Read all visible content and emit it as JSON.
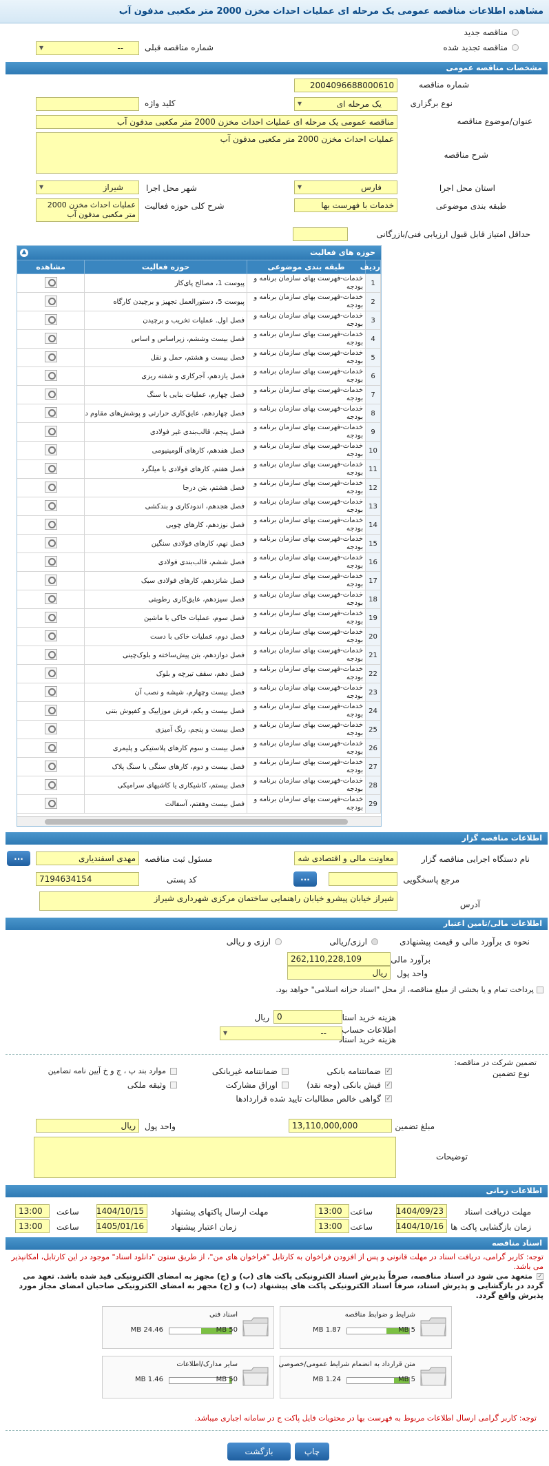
{
  "page_title": "مشاهده اطلاعات مناقصه عمومی یک مرحله ای عملیات احداث مخزن 2000 متر مکعبی مدفون آب",
  "top": {
    "new_tender": "مناقصه جدید",
    "renewed_tender": "مناقصه تجدید شده",
    "prev_number_label": "شماره مناقصه قبلی",
    "prev_number_value": "--"
  },
  "general": {
    "header": "مشخصات مناقصه عمومی",
    "number_label": "شماره مناقصه",
    "number_value": "2004096688000610",
    "type_label": "نوع برگزاری",
    "type_value": "یک مرحله ای",
    "keyword_label": "کلید واژه",
    "keyword_value": "",
    "title_label": "عنوان/موضوع مناقصه",
    "title_value": "مناقصه عمومی یک مرحله ای عملیات احداث مخزن 2000 متر مکعبی مدفون آب",
    "desc_label": "شرح مناقصه",
    "desc_value": "عملیات احداث مخزن 2000 متر مکعبی مدفون آب",
    "province_label": "استان محل اجرا",
    "province_value": "فارس",
    "city_label": "شهر محل اجرا",
    "city_value": "شیراز",
    "category_label": "طبقه بندی موضوعی",
    "category_value": "خدمات با فهرست بها",
    "scope_label": "شرح کلی حوزه فعالیت",
    "scope_value": "عملیات احداث مخزن 2000 متر مکعبی مدفون آب",
    "min_score_label": "حداقل امتیاز قابل قبول ارزیابی فنی/بازرگانی",
    "min_score_value": ""
  },
  "activities": {
    "header": "حوزه های فعالیت",
    "columns": [
      "ردیف",
      "طبقه بندی موضوعی",
      "حوزه فعالیت",
      "مشاهده"
    ],
    "category_text": "خدمات-فهرست بهای سازمان برنامه و بودجه",
    "rows": [
      {
        "n": "1",
        "act": "پیوست 1، مصالح پای‌کار"
      },
      {
        "n": "2",
        "act": "پیوست 5، دستورالعمل تجهیز و برچیدن کارگاه"
      },
      {
        "n": "3",
        "act": "فصل اول. عملیات تخریب و برچیدن"
      },
      {
        "n": "4",
        "act": "فصل بیست وششم، زیراساس و اساس"
      },
      {
        "n": "5",
        "act": "فصل بیست و هشتم، حمل و نقل"
      },
      {
        "n": "6",
        "act": "فصل یازدهم، آجرکاری و شفته ریزی"
      },
      {
        "n": "7",
        "act": "فصل چهارم، عملیات بنایی با سنگ"
      },
      {
        "n": "8",
        "act": "فصل چهاردهم، عایق‌کاری حرارتی و پوشش‌های مقاوم در برابر آتش"
      },
      {
        "n": "9",
        "act": "فصل پنجم، قالب‌بندی غیر فولادی"
      },
      {
        "n": "10",
        "act": "فصل هفدهم، کارهای آلومینیومی"
      },
      {
        "n": "11",
        "act": "فصل هفتم، کارهای فولادی با میلگرد"
      },
      {
        "n": "12",
        "act": "فصل هشتم، بتن درجا"
      },
      {
        "n": "13",
        "act": "فصل هجدهم، اندودکاری و بندکشی"
      },
      {
        "n": "14",
        "act": "فصل نوزدهم، کارهای چوبی"
      },
      {
        "n": "15",
        "act": "فصل نهم، کارهای فولادی سنگین"
      },
      {
        "n": "16",
        "act": "فصل ششم، قالب‌بندی فولادی"
      },
      {
        "n": "17",
        "act": "فصل شانزدهم، کارهای فولادی سبک"
      },
      {
        "n": "18",
        "act": "فصل سیزدهم، عایق‌کاری رطوبتی"
      },
      {
        "n": "19",
        "act": "فصل سوم، عملیات خاکی با ماشین"
      },
      {
        "n": "20",
        "act": "فصل دوم، عملیات خاکی با دست"
      },
      {
        "n": "21",
        "act": "فصل دوازدهم، بتن پیش‌ساخته و بلوک‌چینی"
      },
      {
        "n": "22",
        "act": "فصل دهم، سقف تیرچه و بلوک"
      },
      {
        "n": "23",
        "act": "فصل بیست وچهارم، شیشه و نصب آن"
      },
      {
        "n": "24",
        "act": "فصل بیست و یکم، فرش موزاییک و کفپوش بتنی"
      },
      {
        "n": "25",
        "act": "فصل بیست و پنجم، رنگ آمیزی"
      },
      {
        "n": "26",
        "act": "فصل بیست و سوم کارهای پلاستیکی و پلیمری"
      },
      {
        "n": "27",
        "act": "فصل بیست و دوم، کارهای سنگی با سنگ پلاک"
      },
      {
        "n": "28",
        "act": "فصل بیستم، کاشیکاری یا کاشیهای سرامیکی"
      },
      {
        "n": "29",
        "act": "فصل بیست وهفتم، آسفالت"
      }
    ]
  },
  "organizer": {
    "header": "اطلاعات مناقصه گزار",
    "org_label": "نام دستگاه اجرایی مناقصه گزار",
    "org_value": "معاونت مالی و اقتصادی شه",
    "resp_label": "مسئول ثبت مناقصه",
    "resp_value": "مهدی اسفندیاری",
    "ref_label": "مرجع پاسخگویی",
    "ref_value": "",
    "postal_label": "کد پستی",
    "postal_value": "7194634154",
    "address_label": "آدرس",
    "address_value": "شیراز خیابان پیشرو خیابان راهنمایی ساختمان مرکزی شهرداری شیراز",
    "dots": "..."
  },
  "finance": {
    "header": "اطلاعات مالی/تامین اعتبار",
    "estimate_label": "نحوه ی برآورد مالی و قیمت پیشنهادی",
    "opt_rial": "ارزی/ریالی",
    "opt_fx_rial": "ارزی و ریالی",
    "estimate_amount_label": "برآورد مالی",
    "estimate_amount_value": "262,110,228,109",
    "currency_label": "واحد پول",
    "currency_value": "ریال",
    "treasury_note": "پرداخت تمام و یا بخشی از مبلغ مناقصه، از محل \"اسناد خزانه اسلامی\" خواهد بود.",
    "doc_fee_label": "هزینه خرید اسناد",
    "doc_fee_value": "0",
    "doc_fee_unit": "ریال",
    "account_label": "اطلاعات حساب جهت واریز هزینه خرید اسناد",
    "account_value": "--",
    "guarantee_label": "نوع تضمین",
    "guarantee_hint": "تضمین شرکت در مناقصه:",
    "g_bank": "ضمانتنامه بانکی",
    "g_nonbank": "ضمانتنامه غیربانکی",
    "g_other": "موارد بند پ ، ج و خ آیین نامه تضامین",
    "g_check": "فیش بانکی (وجه نقد)",
    "g_bonds": "اوراق مشارکت",
    "g_property": "وثیقه ملکی",
    "g_claims": "گواهی خالص مطالبات تایید شده قراردادها",
    "g_amount_label": "مبلغ تضمین",
    "g_amount_value": "13,110,000,000",
    "g_currency_label": "واحد پول",
    "g_currency_value": "ریال",
    "notes_label": "توضیحات",
    "notes_value": ""
  },
  "timing": {
    "header": "اطلاعات زمانی",
    "doc_deadline_label": "مهلت دریافت اسناد",
    "doc_deadline_date": "1404/09/23",
    "send_deadline_label": "مهلت ارسال پاکتهای پیشنهاد",
    "send_deadline_date": "1404/10/15",
    "open_label": "زمان بازگشایی پاکت ها",
    "open_date": "1404/10/16",
    "validity_label": "زمان اعتبار پیشنهاد",
    "validity_date": "1405/01/16",
    "time_label": "ساعت",
    "t1": "13:00",
    "t2": "13:00",
    "t3": "13:00",
    "t4": "13:00"
  },
  "docs": {
    "header": "اسناد مناقصه",
    "note1": "توجه: کاربر گرامی، دریافت اسناد در مهلت قانونی و پس از افزودن فراخوان به کارتابل \"فراخوان های من\"، از طریق ستون \"دانلود اسناد\" موجود در این کارتابل، امکانپذیر می باشد.",
    "note2": "متعهد می شود در اسناد مناقصه، صرفاً بذیرش اسناد الکترونیکی پاکت های (ب) و (ج) مجهز به امضای الکترونیکی قید شده باشد. تعهد می گردد در بازگشایی و پذیرش اسناد، صرفاً اسناد الکترونیکی پاکت های پیشنهاد (ب) و (ج) مجهز به امضای الکترونیکی صاحبان امضای مجاز مورد پذیرش واقع گردد.",
    "files": [
      {
        "title": "شرایط و ضوابط مناقصه",
        "max": "5 MB",
        "size": "1.87 MB",
        "fill": 0.37
      },
      {
        "title": "اسناد فنی",
        "max": "50 MB",
        "size": "24.46 MB",
        "fill": 0.49
      },
      {
        "title": "متن قرارداد به انضمام شرایط عمومی/خصوصی",
        "max": "5 MB",
        "size": "1.24 MB",
        "fill": 0.25
      },
      {
        "title": "سایر مدارک/اطلاعات",
        "max": "50 MB",
        "size": "1.46 MB",
        "fill": 0.03
      }
    ],
    "note3": "توجه: کاربر گرامی ارسال اطلاعات مربوط به فهرست بها در محتویات فایل پاکت ج در سامانه اجباری میباشد."
  },
  "actions": {
    "print": "چاپ",
    "back": "بازگشت"
  }
}
